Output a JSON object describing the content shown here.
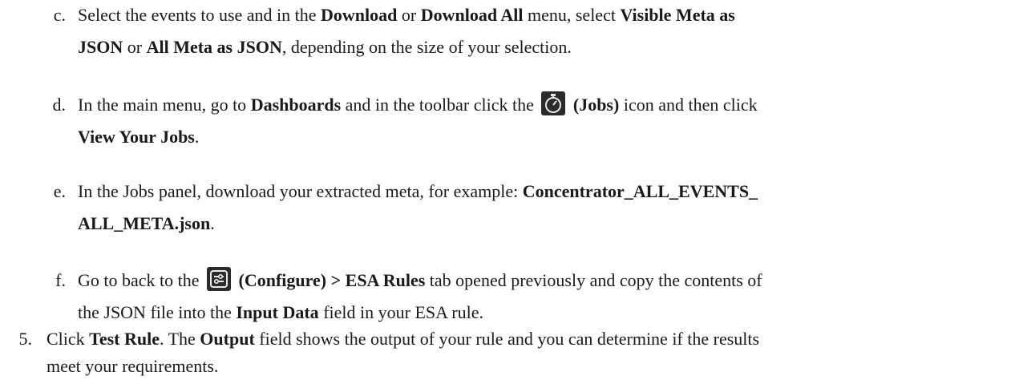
{
  "items": [
    {
      "marker": "c.",
      "lines": [
        [
          "Select the events to use and in the ",
          {
            "b": "Download"
          },
          " or ",
          {
            "b": "Download All"
          },
          " menu, select ",
          {
            "b": "Visible Meta as"
          }
        ],
        [
          {
            "b": "JSON"
          },
          " or ",
          {
            "b": "All Meta as JSON"
          },
          ", depending on the size of your selection."
        ]
      ]
    },
    {
      "marker": "d.",
      "lines": [
        [
          "In the main menu, go to ",
          {
            "b": "Dashboards"
          },
          " and in the toolbar click the ",
          {
            "icon": "stopwatch-icon"
          },
          " ",
          {
            "b": "(Jobs)"
          },
          " icon and then click"
        ],
        [
          {
            "b": "View Your Jobs"
          },
          "."
        ]
      ]
    },
    {
      "marker": "e.",
      "lines": [
        [
          "In the Jobs panel, download your extracted meta, for example: ",
          {
            "b": "Concentrator_ALL_EVENTS_"
          }
        ],
        [
          {
            "b": "ALL_META.json"
          },
          "."
        ]
      ]
    },
    {
      "marker": "f.",
      "lines": [
        [
          "Go to back to the ",
          {
            "icon": "configure-icon"
          },
          " ",
          {
            "b": "(Configure) > ESA Rules"
          },
          " tab opened previously and copy the contents of"
        ],
        [
          "the JSON file into the ",
          {
            "b": "Input Data"
          },
          " field in your ESA rule."
        ]
      ]
    },
    {
      "marker": "5.",
      "lines": [
        [
          "Click ",
          {
            "b": "Test Rule"
          },
          ". The ",
          {
            "b": "Output"
          },
          " field shows the output of your rule and you can determine if the results"
        ],
        [
          "meet your requirements."
        ]
      ]
    }
  ]
}
